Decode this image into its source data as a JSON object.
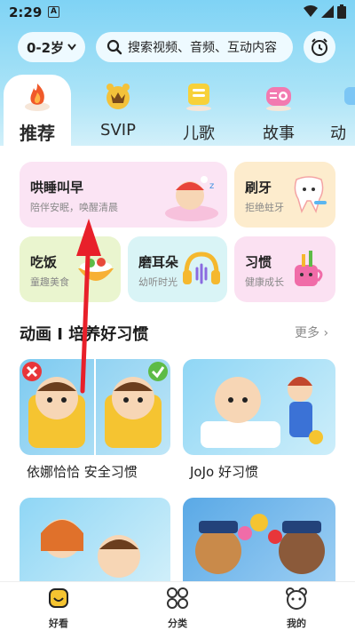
{
  "status_bar": {
    "time": "2:29",
    "badge": "A"
  },
  "header": {
    "age_selector": "0-2岁",
    "search_placeholder": "搜索视频、音频、互动内容"
  },
  "tabs": [
    {
      "label": "推荐",
      "active": true
    },
    {
      "label": "SVIP"
    },
    {
      "label": "儿歌"
    },
    {
      "label": "故事"
    },
    {
      "label": "动"
    }
  ],
  "cards": {
    "sleep": {
      "title": "哄睡叫早",
      "subtitle": "陪伴安眠，唤醒清晨"
    },
    "brush": {
      "title": "刷牙",
      "subtitle": "拒绝蛀牙"
    },
    "eat": {
      "title": "吃饭",
      "subtitle": "童趣美食"
    },
    "ear": {
      "title": "磨耳朵",
      "subtitle": "幼听时光"
    },
    "habit": {
      "title": "习惯",
      "subtitle": "健康成长"
    }
  },
  "section": {
    "title": "动画 I 培养好习惯",
    "more": "更多"
  },
  "videos": [
    {
      "caption": "依娜恰恰 安全习惯"
    },
    {
      "caption": "JoJo 好习惯"
    }
  ],
  "bottom_nav": [
    {
      "label": "好看"
    },
    {
      "label": "分类"
    },
    {
      "label": "我的"
    }
  ],
  "colors": {
    "accent": "#f08a1c",
    "annotation_arrow": "#e8202a"
  }
}
